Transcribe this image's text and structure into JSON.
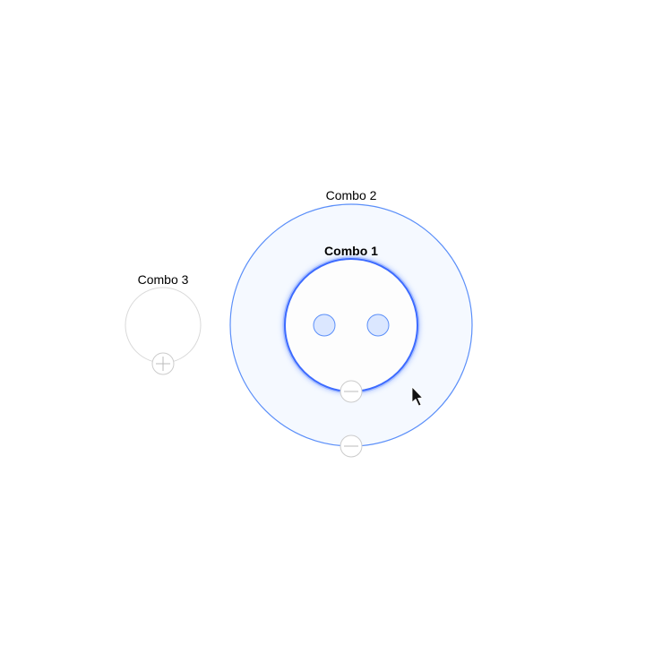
{
  "graph": {
    "combos": [
      {
        "id": "combo-1",
        "label": "Combo 1",
        "state": "selected",
        "collapse_control": "minus-icon"
      },
      {
        "id": "combo-2",
        "label": "Combo 2",
        "state": "expanded",
        "collapse_control": "minus-icon"
      },
      {
        "id": "combo-3",
        "label": "Combo 3",
        "state": "collapsed",
        "collapse_control": "plus-icon"
      }
    ],
    "nodes": [
      {
        "id": "node-1",
        "combo": "combo-1"
      },
      {
        "id": "node-2",
        "combo": "combo-1"
      }
    ]
  },
  "colors": {
    "background": "#ffffff",
    "combo_expanded_fill": "#f5f9ff",
    "combo_expanded_stroke": "#5b8ff9",
    "combo_selected_stroke": "#3d6bff",
    "combo_selected_fill": "#fdfdfd",
    "combo_collapsed_stroke": "#d9d9d9",
    "combo_collapsed_fill": "#ffffff",
    "node_fill": "#dbe7ff",
    "node_stroke": "#5b8ff9",
    "control_stroke": "#cccccc",
    "control_fill": "#ffffff"
  },
  "cursor": "arrow-pointer-icon"
}
